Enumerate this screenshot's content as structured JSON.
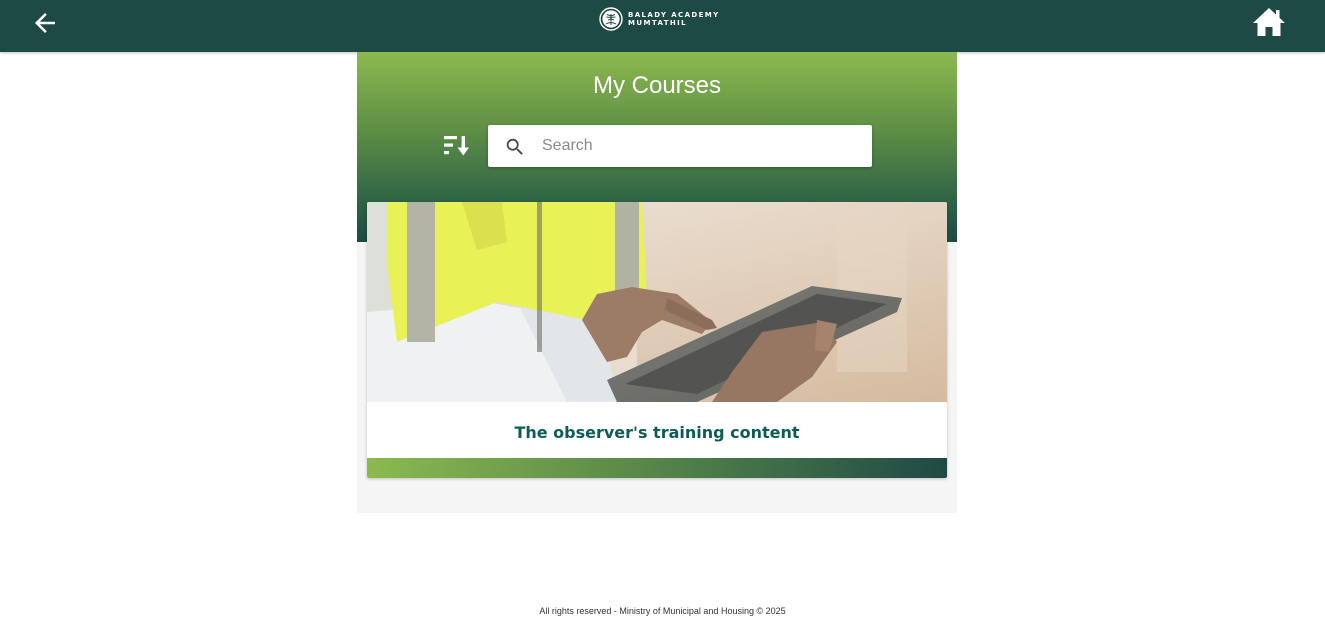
{
  "header": {
    "back_icon": "arrow-left-icon",
    "home_icon": "home-icon",
    "logo": {
      "line1": "BALADY ACADEMY",
      "line2": "MUMTATHIL"
    }
  },
  "main": {
    "title": "My Courses",
    "sort_icon": "sort-descending-icon",
    "search": {
      "placeholder": "Search",
      "value": ""
    },
    "courses": [
      {
        "title": "The observer's training content"
      }
    ]
  },
  "footer": {
    "text": "All rights reserved - Ministry of Municipal and Housing © 2025"
  },
  "colors": {
    "header_bg": "#1e4a45",
    "hero_top": "#8cb94f",
    "hero_bottom": "#1e4a45",
    "card_title": "#0d5c58"
  }
}
